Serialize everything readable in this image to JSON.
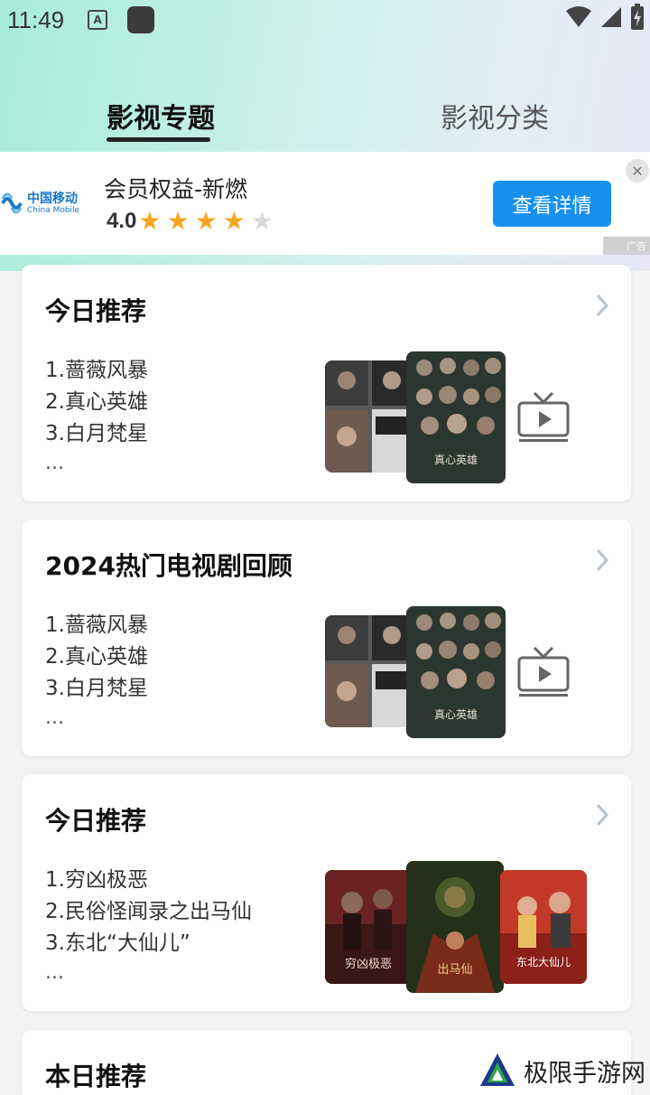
{
  "status_bar": {
    "time": "11:49",
    "notif_letter": "A"
  },
  "tabs": [
    {
      "label": "影视专题",
      "active": true
    },
    {
      "label": "影视分类",
      "active": false
    }
  ],
  "ad": {
    "brand_cn": "中国移动",
    "brand_en": "China Mobile",
    "title": "会员权益-新燃",
    "rating": "4.0",
    "stars_filled": 4,
    "stars_total": 5,
    "button": "查看详情",
    "close": "✕",
    "badge": "广告"
  },
  "cards": [
    {
      "title": "今日推荐",
      "items": [
        "1.蔷薇风暴",
        "2.真心英雄",
        "3.白月梵星"
      ],
      "more": "...",
      "poster_text": "真心英雄"
    },
    {
      "title": "2024热门电视剧回顾",
      "items": [
        "1.蔷薇风暴",
        "2.真心英雄",
        "3.白月梵星"
      ],
      "more": "...",
      "poster_text": "真心英雄"
    },
    {
      "title": "今日推荐",
      "items": [
        "1.穷凶极恶",
        "2.民俗怪闻录之出马仙",
        "3.东北“大仙儿”"
      ],
      "more": "...",
      "poster_texts": [
        "穷凶极恶",
        "出马仙",
        "东北大仙儿"
      ]
    },
    {
      "title": "本日推荐"
    }
  ],
  "watermark": {
    "text": "极限手游网"
  },
  "colors": {
    "accent_blue": "#1890f0",
    "star_gold": "#f5a623",
    "header_mint": "#a8ecd8"
  }
}
